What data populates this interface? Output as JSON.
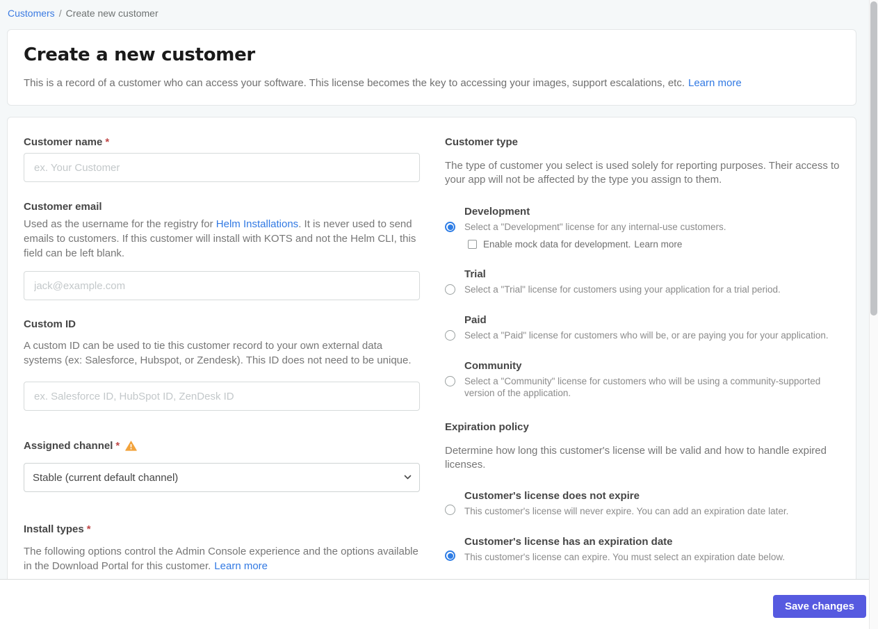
{
  "breadcrumb": {
    "customers": "Customers",
    "separator": "/",
    "current": "Create new customer"
  },
  "header": {
    "title": "Create a new customer",
    "description": "This is a record of a customer who can access your software. This license becomes the key to accessing your images, support escalations, etc.",
    "learn_more": "Learn more"
  },
  "form": {
    "customer_name": {
      "label": "Customer name",
      "required": "*",
      "placeholder": "ex. Your Customer",
      "value": ""
    },
    "customer_email": {
      "label": "Customer email",
      "description_before": "Used as the username for the registry for ",
      "description_link": "Helm Installations",
      "description_after": ". It is never used to send emails to customers. If this customer will install with KOTS and not the Helm CLI, this field can be left blank.",
      "placeholder": "jack@example.com",
      "value": ""
    },
    "custom_id": {
      "label": "Custom ID",
      "description": "A custom ID can be used to tie this customer record to your own external data systems (ex: Salesforce, Hubspot, or Zendesk). This ID does not need to be unique.",
      "placeholder": "ex. Salesforce ID, HubSpot ID, ZenDesk ID",
      "value": ""
    },
    "assigned_channel": {
      "label": "Assigned channel",
      "required": "*",
      "selected_option": "Stable (current default channel)"
    },
    "install_types": {
      "label": "Install types",
      "required": "*",
      "description": "The following options control the Admin Console experience and the options available in the Download Portal for this customer.",
      "learn_more": "Learn more"
    }
  },
  "customer_type": {
    "title": "Customer type",
    "description": "The type of customer you select is used solely for reporting purposes. Their access to your app will not be affected by the type you assign to them.",
    "options": [
      {
        "label": "Development",
        "description": "Select a \"Development\" license for any internal-use customers.",
        "selected": true
      },
      {
        "label": "Trial",
        "description": "Select a \"Trial\" license for customers using your application for a trial period.",
        "selected": false
      },
      {
        "label": "Paid",
        "description": "Select a \"Paid\" license for customers who will be, or are paying you for your application.",
        "selected": false
      },
      {
        "label": "Community",
        "description": "Select a \"Community\" license for customers who will be using a community-supported version of the application.",
        "selected": false
      }
    ],
    "mock_data_checkbox": {
      "label": "Enable mock data for development.",
      "learn_more": "Learn more",
      "checked": false
    }
  },
  "expiration_policy": {
    "title": "Expiration policy",
    "description": "Determine how long this customer's license will be valid and how to handle expired licenses.",
    "options": [
      {
        "label": "Customer's license does not expire",
        "description": "This customer's license will never expire. You can add an expiration date later.",
        "selected": false
      },
      {
        "label": "Customer's license has an expiration date",
        "description": "This customer's license can expire. You must select an expiration date below.",
        "selected": true
      }
    ]
  },
  "footer": {
    "save_button": "Save changes"
  },
  "colors": {
    "accent": "#565ae0",
    "link": "#3179e3",
    "radio_selected": "#2e7de5",
    "warning": "#f2a33c",
    "required": "#c04848",
    "page_background": "#f5f8f9"
  }
}
